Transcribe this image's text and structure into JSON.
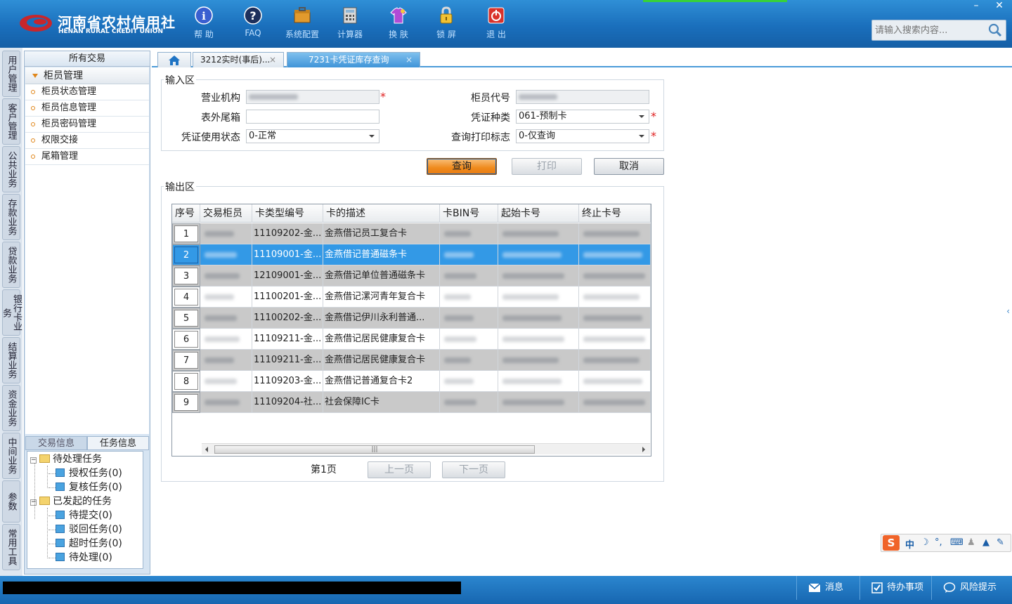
{
  "header": {
    "logo_cn": "河南省农村信用社",
    "logo_en": "HENAN RURAL CREDIT UNION",
    "tools": [
      {
        "label": "帮 助",
        "icon": "info-icon"
      },
      {
        "label": "FAQ",
        "icon": "question-icon"
      },
      {
        "label": "系统配置",
        "icon": "toolbox-icon"
      },
      {
        "label": "计算器",
        "icon": "calculator-icon"
      },
      {
        "label": "换 肤",
        "icon": "shirt-icon"
      },
      {
        "label": "锁 屏",
        "icon": "lock-icon"
      },
      {
        "label": "退 出",
        "icon": "power-icon"
      }
    ],
    "search_placeholder": "请输入搜索内容..."
  },
  "window": {
    "minimize": "–",
    "close": "✕"
  },
  "vtabs": [
    "用户管理",
    "客户管理",
    "公共业务",
    "存款业务",
    "贷款业务",
    "银行卡业务",
    "结算业务",
    "资金业务",
    "中间业务",
    "参数",
    "常用工具"
  ],
  "sidebar": {
    "title": "所有交易",
    "group": "柜员管理",
    "items": [
      "柜员状态管理",
      "柜员信息管理",
      "柜员密码管理",
      "权限交接",
      "尾箱管理"
    ],
    "bottom_tabs": [
      "交易信息",
      "任务信息"
    ],
    "tree": {
      "pending": "待处理任务",
      "pending_children": [
        "授权任务(0)",
        "复核任务(0)"
      ],
      "initiated": "已发起的任务",
      "initiated_children": [
        "待提交(0)",
        "驳回任务(0)",
        "超时任务(0)",
        "待处理(0)"
      ]
    }
  },
  "tabs": [
    {
      "label": "3212实时(事后)...",
      "close": "×"
    },
    {
      "label": "7231卡凭证库存查询",
      "close": "×"
    }
  ],
  "form": {
    "input_legend": "输入区",
    "output_legend": "输出区",
    "labels": {
      "org": "营业机构",
      "teller_code": "柜员代号",
      "box": "表外尾箱",
      "voucher_type": "凭证种类",
      "voucher_status": "凭证使用状态",
      "print_flag": "查询打印标志"
    },
    "values": {
      "voucher_type": "061-预制卡",
      "voucher_status": "0-正常",
      "print_flag": "0-仅查询"
    },
    "required_mark": "*"
  },
  "buttons": {
    "query": "查询",
    "print": "打印",
    "cancel": "取消"
  },
  "grid": {
    "columns": [
      "序号",
      "交易柜员",
      "卡类型编号",
      "卡的描述",
      "卡BIN号",
      "起始卡号",
      "终止卡号"
    ],
    "rows": [
      {
        "no": "1",
        "type": "11109202-金...",
        "desc": "金燕借记员工复合卡"
      },
      {
        "no": "2",
        "type": "11109001-金...",
        "desc": "金燕借记普通磁条卡"
      },
      {
        "no": "3",
        "type": "12109001-金...",
        "desc": "金燕借记单位普通磁条卡"
      },
      {
        "no": "4",
        "type": "11100201-金...",
        "desc": "金燕借记漯河青年复合卡"
      },
      {
        "no": "5",
        "type": "11100202-金...",
        "desc": "金燕借记伊川永利普通..."
      },
      {
        "no": "6",
        "type": "11109211-金...",
        "desc": "金燕借记居民健康复合卡"
      },
      {
        "no": "7",
        "type": "11109211-金...",
        "desc": "金燕借记居民健康复合卡"
      },
      {
        "no": "8",
        "type": "11109203-金...",
        "desc": "金燕借记普通复合卡2"
      },
      {
        "no": "9",
        "type": "11109204-社...",
        "desc": "社会保障IC卡"
      }
    ],
    "selected_row": 2,
    "scroll_grip": "|||"
  },
  "pager": {
    "page": "第1页",
    "prev": "上一页",
    "next": "下一页"
  },
  "statusbar": {
    "message": "消息",
    "todo": "待办事项",
    "risk": "风险提示"
  },
  "ime": {
    "logo": "S",
    "mode": "中"
  },
  "colors": {
    "header": "#1a6fbc",
    "accent": "#3399e6",
    "primary_button": "#ef8a1c"
  }
}
